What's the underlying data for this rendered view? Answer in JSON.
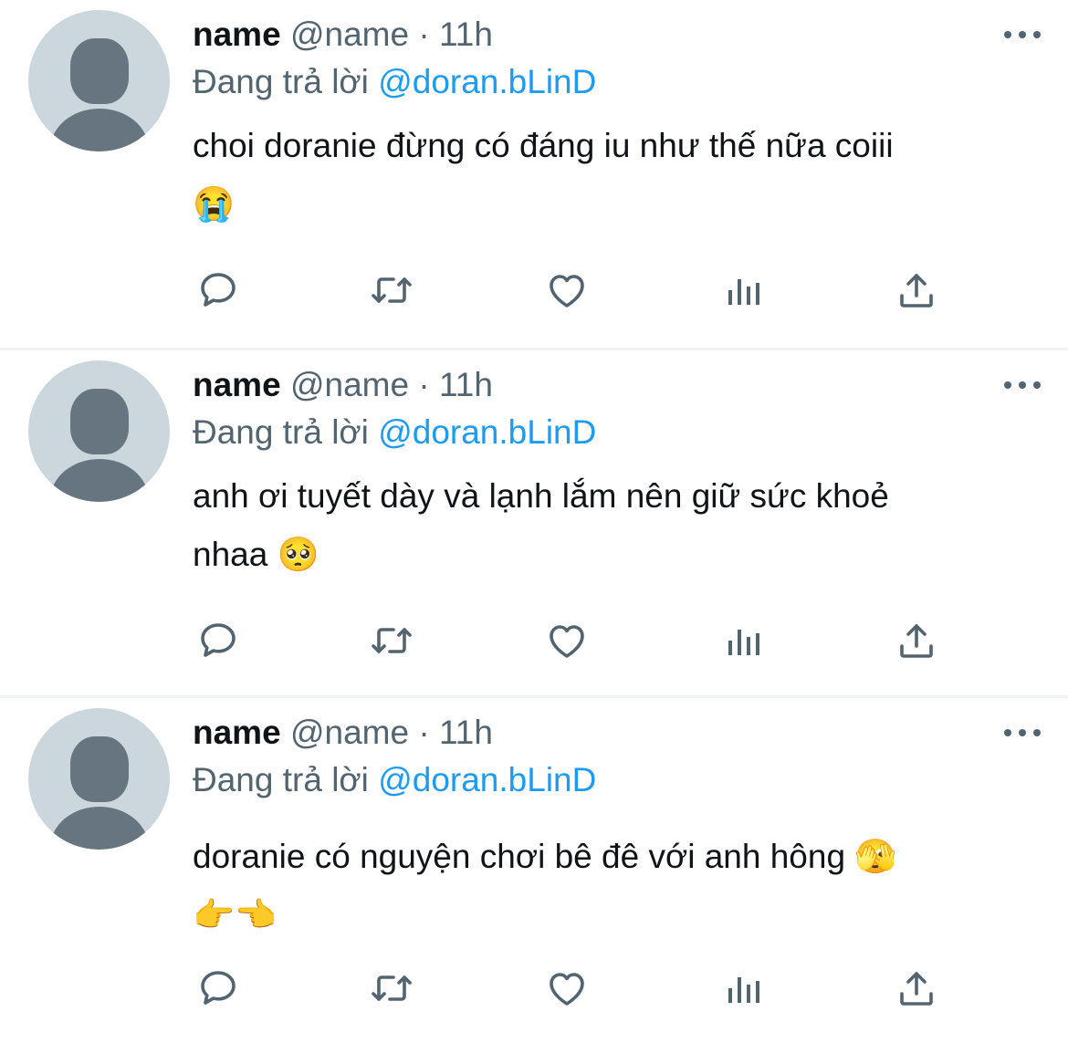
{
  "tweets": [
    {
      "name": "name",
      "handle": "@name",
      "separator": "·",
      "time": "11h",
      "reply_prefix": "Đang trả lời",
      "reply_to": "@doran.bLinD",
      "text": "choi doranie đừng có đáng iu như thế nữa coiii\n😭",
      "actions": [
        "reply-icon",
        "retweet-icon",
        "like-icon",
        "analytics-icon",
        "share-icon"
      ]
    },
    {
      "name": "name",
      "handle": "@name",
      "separator": "·",
      "time": "11h",
      "reply_prefix": "Đang trả lời",
      "reply_to": "@doran.bLinD",
      "text": "anh ơi tuyết dày và lạnh lắm nên giữ sức khoẻ\nnhaa 🥺",
      "actions": [
        "reply-icon",
        "retweet-icon",
        "like-icon",
        "analytics-icon",
        "share-icon"
      ]
    },
    {
      "name": "name",
      "handle": "@name",
      "separator": "·",
      "time": "11h",
      "reply_prefix": "Đang trả lời",
      "reply_to": "@doran.bLinD",
      "text": "doranie có nguyện chơi bê đê với anh hông 🫣\n👉👈",
      "actions": [
        "reply-icon",
        "retweet-icon",
        "like-icon",
        "analytics-icon",
        "share-icon"
      ]
    }
  ],
  "colors": {
    "text": "#0f1419",
    "secondary": "#536471",
    "link": "#1d9bf0",
    "divider": "#eff3f4",
    "avatar_bg": "#ccd6dd",
    "avatar_fg": "#66757f"
  }
}
